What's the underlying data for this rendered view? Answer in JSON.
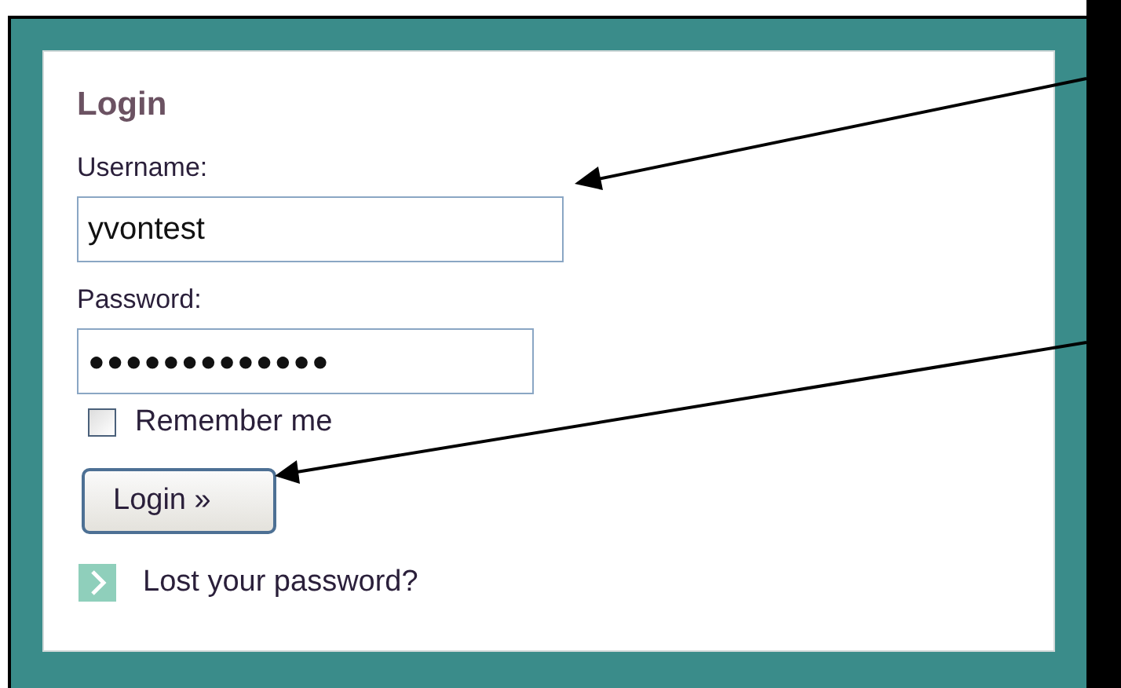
{
  "login_box": {
    "title": "Login",
    "username": {
      "label": "Username:",
      "value": "yvontest"
    },
    "password": {
      "label": "Password:",
      "value": "●●●●●●●●●●●●●"
    },
    "remember_me": {
      "label": "Remember me",
      "checked": false
    },
    "login_button": {
      "label": "Login »"
    },
    "lost_password_link": {
      "label": "Lost your password?"
    }
  }
}
